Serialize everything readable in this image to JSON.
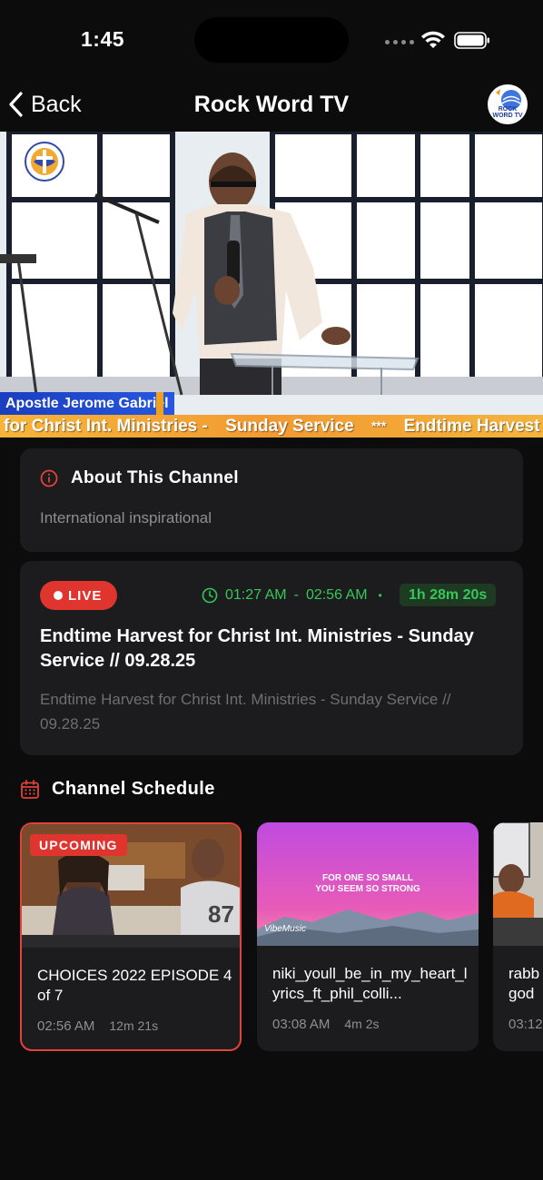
{
  "status_bar": {
    "time": "1:45"
  },
  "nav": {
    "back_label": "Back",
    "title": "Rock Word TV",
    "logo_text": "ROCK WORD TV"
  },
  "video": {
    "name_caption": "Apostle Jerome Gabriel",
    "ticker": [
      "for Christ Int. Ministries -",
      "Sunday Service",
      "***",
      "Endtime Harvest for"
    ]
  },
  "about": {
    "title": "About This Channel",
    "description": "International inspirational"
  },
  "current_program": {
    "live_label": "LIVE",
    "start": "01:27 AM",
    "dash": "-",
    "end": "02:56 AM",
    "separator": "•",
    "remaining": "1h 28m 20s",
    "title": "Endtime Harvest for Christ Int. Ministries - Sunday Service // 09.28.25",
    "description": "Endtime Harvest for Christ Int. Ministries - Sunday Service // 09.28.25"
  },
  "schedule": {
    "title": "Channel Schedule",
    "items": [
      {
        "badge": "UPCOMING",
        "title": "CHOICES 2022 EPISODE 4 of 7",
        "time": "02:56 AM",
        "duration": "12m 21s"
      },
      {
        "title": "niki_youll_be_in_my_heart_lyrics_ft_phil_colli...",
        "time": "03:08 AM",
        "duration": "4m 2s",
        "thumb_text_1": "FOR ONE SO SMALL",
        "thumb_text_2": "YOU SEEM SO STRONG",
        "thumb_watermark": "VibeMusic"
      },
      {
        "title": "rabb god",
        "time": "03:12"
      }
    ]
  },
  "colors": {
    "accent_red": "#e0342f",
    "live_green": "#34c759",
    "card_bg": "#1c1c1e",
    "bg": "#0c0c0c"
  }
}
